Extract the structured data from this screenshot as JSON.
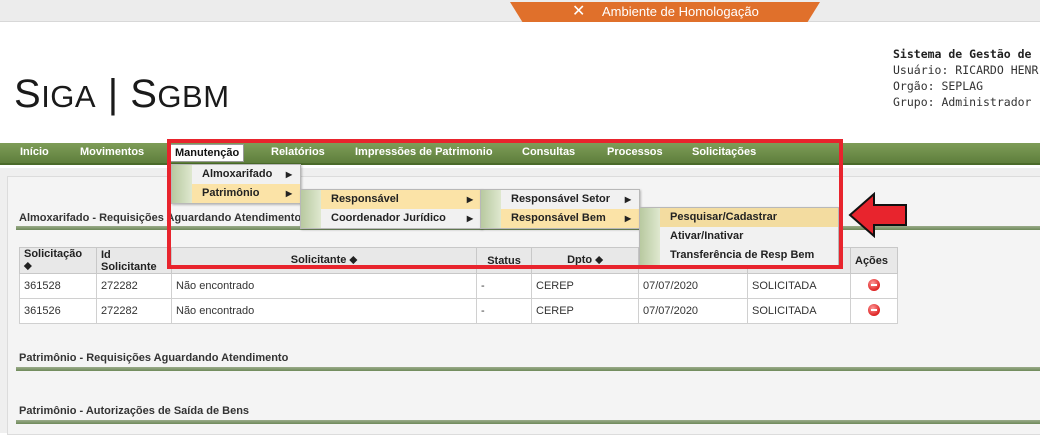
{
  "env": {
    "label": "Ambiente de Homologação",
    "icon": "tools-icon"
  },
  "logo": {
    "text_part1": "SiGA",
    "separator": "|",
    "text_part2": "SGBM"
  },
  "sysinfo": {
    "title": "Sistema de Gestão de",
    "user": "Usuário: RICARDO HENR",
    "org": "Orgão: SEPLAG",
    "group": "Grupo: Administrador"
  },
  "nav": {
    "items": [
      "Início",
      "Movimentos",
      "Manutenção",
      "Relatórios",
      "Impressões de Patrimonio",
      "Consultas",
      "Processos",
      "Solicitações"
    ]
  },
  "menu1": [
    "Almoxarifado",
    "Patrimônio"
  ],
  "menu2": [
    "Responsável",
    "Coordenador Jurídico"
  ],
  "menu3": [
    "Responsável Setor",
    "Responsável Bem"
  ],
  "menu4": [
    "Pesquisar/Cadastrar",
    "Ativar/Inativar",
    "Transferência de Resp Bem"
  ],
  "sections": {
    "almox": "Almoxarifado - Requisições Aguardando Atendimento",
    "patrimonio_req": "Patrimônio - Requisições Aguardando Atendimento",
    "patrimonio_aut": "Patrimônio - Autorizações de Saída de Bens"
  },
  "table": {
    "headers": [
      "Solicitação ⬥",
      "Id Solicitante",
      "Solicitante ⬥",
      "Status",
      "Dpto ⬥",
      "",
      "",
      "Ações"
    ],
    "rows": [
      [
        "361528",
        "272282",
        "Não encontrado",
        "-",
        "CEREP",
        "07/07/2020",
        "SOLICITADA"
      ],
      [
        "361526",
        "272282",
        "Não encontrado",
        "-",
        "CEREP",
        "07/07/2020",
        "SOLICITADA"
      ]
    ]
  },
  "colors": {
    "accent": "#e0702b",
    "nav": "#6b8a47",
    "highlight": "#e8242d"
  }
}
